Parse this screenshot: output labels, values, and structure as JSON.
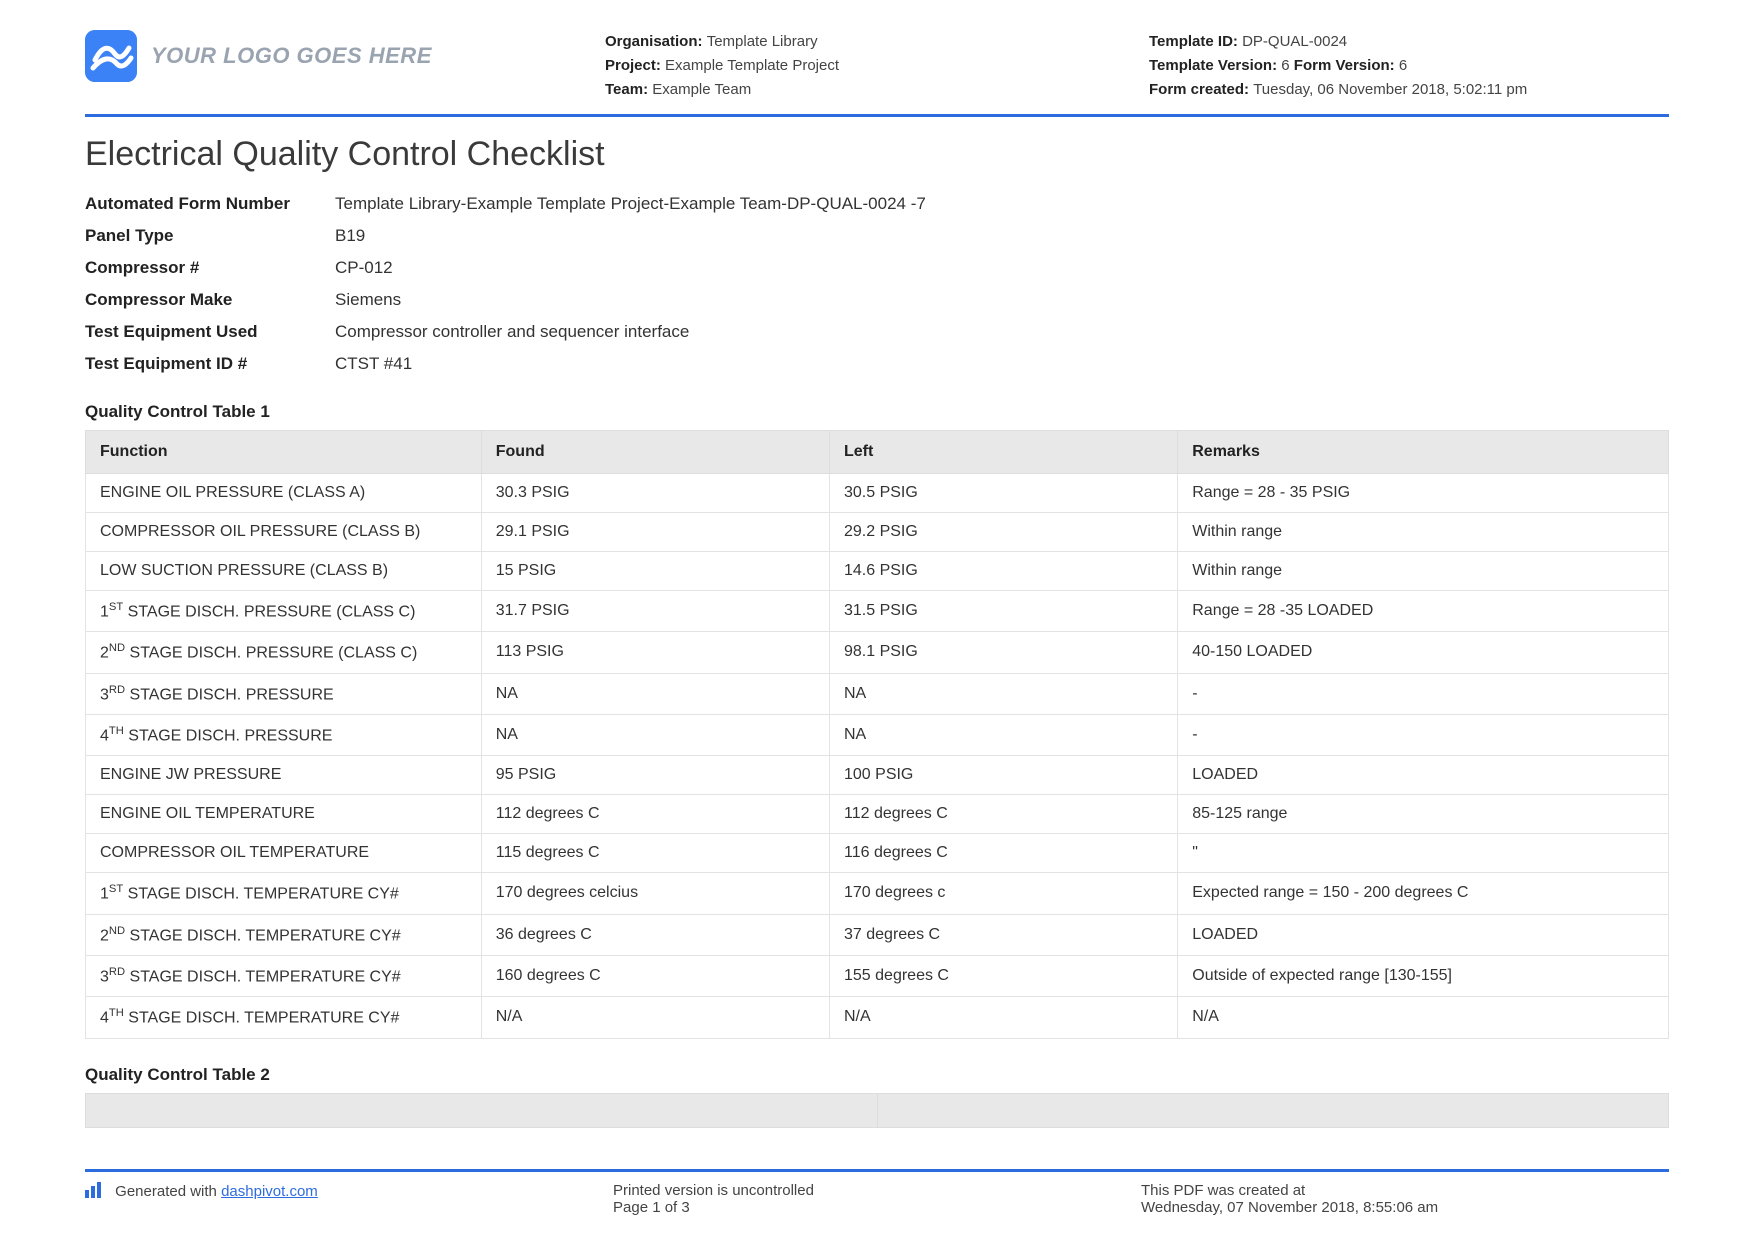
{
  "header": {
    "logo_placeholder": "YOUR LOGO GOES HERE",
    "organisation_label": "Organisation:",
    "organisation_value": "Template Library",
    "project_label": "Project:",
    "project_value": "Example Template Project",
    "team_label": "Team:",
    "team_value": "Example Team",
    "template_id_label": "Template ID:",
    "template_id_value": "DP-QUAL-0024",
    "template_version_label": "Template Version:",
    "template_version_value": "6",
    "form_version_label": "Form Version:",
    "form_version_value": "6",
    "form_created_label": "Form created:",
    "form_created_value": "Tuesday, 06 November 2018, 5:02:11 pm"
  },
  "title": "Electrical Quality Control Checklist",
  "meta": [
    {
      "label": "Automated Form Number",
      "value": "Template Library-Example Template Project-Example Team-DP-QUAL-0024   -7"
    },
    {
      "label": "Panel Type",
      "value": "B19"
    },
    {
      "label": "Compressor #",
      "value": "CP-012"
    },
    {
      "label": "Compressor Make",
      "value": "Siemens"
    },
    {
      "label": "Test Equipment Used",
      "value": "Compressor controller and sequencer interface"
    },
    {
      "label": "Test Equipment ID #",
      "value": "CTST #41"
    }
  ],
  "table1": {
    "heading": "Quality Control Table 1",
    "columns": [
      "Function",
      "Found",
      "Left",
      "Remarks"
    ],
    "rows": [
      {
        "func": "ENGINE OIL PRESSURE (CLASS A)",
        "found": "30.3 PSIG",
        "left": "30.5 PSIG",
        "remarks": "Range = 28 - 35 PSIG"
      },
      {
        "func": "COMPRESSOR OIL PRESSURE (CLASS B)",
        "found": "29.1 PSIG",
        "left": "29.2 PSIG",
        "remarks": "Within range"
      },
      {
        "func": "LOW SUCTION PRESSURE (CLASS B)",
        "found": "15 PSIG",
        "left": "14.6 PSIG",
        "remarks": "Within range"
      },
      {
        "func_html": "1<span class='sup'>ST</span> STAGE DISCH. PRESSURE (CLASS C)",
        "found": "31.7 PSIG",
        "left": "31.5 PSIG",
        "remarks": "Range = 28 -35 LOADED"
      },
      {
        "func_html": "2<span class='sup'>ND</span> STAGE DISCH. PRESSURE (CLASS C)",
        "found": "113 PSIG",
        "left": "98.1 PSIG",
        "remarks": "40-150 LOADED"
      },
      {
        "func_html": "3<span class='sup'>RD</span> STAGE DISCH. PRESSURE",
        "found": "NA",
        "left": "NA",
        "remarks": "-"
      },
      {
        "func_html": "4<span class='sup'>TH</span> STAGE DISCH. PRESSURE",
        "found": "NA",
        "left": "NA",
        "remarks": "-"
      },
      {
        "func": "ENGINE JW PRESSURE",
        "found": "95 PSIG",
        "left": "100 PSIG",
        "remarks": "LOADED"
      },
      {
        "func": "ENGINE OIL TEMPERATURE",
        "found": "112 degrees C",
        "left": "112 degrees C",
        "remarks": "85-125 range"
      },
      {
        "func": "COMPRESSOR OIL TEMPERATURE",
        "found": "115 degrees C",
        "left": "116 degrees C",
        "remarks": "\""
      },
      {
        "func_html": "1<span class='sup'>ST</span> STAGE DISCH. TEMPERATURE CY#",
        "found": "170 degrees celcius",
        "left": "170 degrees c",
        "remarks": "Expected range = 150 - 200 degrees C"
      },
      {
        "func_html": "2<span class='sup'>ND</span> STAGE DISCH. TEMPERATURE CY#",
        "found": "36 degrees C",
        "left": "37 degrees C",
        "remarks": "LOADED"
      },
      {
        "func_html": "3<span class='sup'>RD</span> STAGE DISCH. TEMPERATURE CY#",
        "found": "160 degrees C",
        "left": "155 degrees C",
        "remarks": "Outside of expected range [130-155]"
      },
      {
        "func_html": "4<span class='sup'>TH</span> STAGE DISCH. TEMPERATURE CY#",
        "found": "N/A",
        "left": "N/A",
        "remarks": "N/A"
      }
    ]
  },
  "table2": {
    "heading": "Quality Control Table 2"
  },
  "footer": {
    "generated_prefix": "Generated with ",
    "generated_link": "dashpivot.com",
    "uncontrolled": "Printed version is uncontrolled",
    "page": "Page 1 of 3",
    "created_label": "This PDF was created at",
    "created_value": "Wednesday, 07 November 2018, 8:55:06 am"
  }
}
